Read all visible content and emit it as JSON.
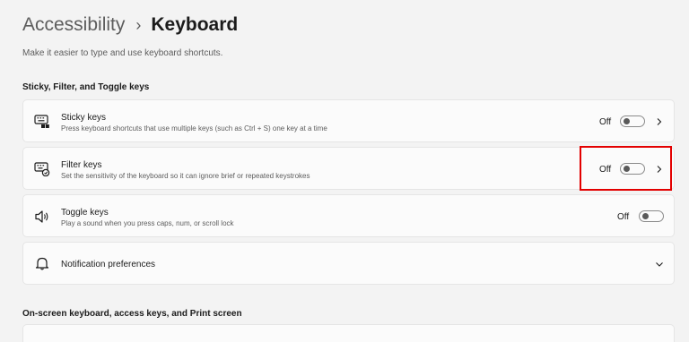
{
  "breadcrumb": {
    "parent": "Accessibility",
    "separator": "›",
    "current": "Keyboard"
  },
  "description": "Make it easier to type and use keyboard shortcuts.",
  "sections": {
    "sticky_filter_toggle": "Sticky, Filter, and Toggle keys",
    "onscreen": "On-screen keyboard, access keys, and Print screen"
  },
  "settings": {
    "sticky": {
      "title": "Sticky keys",
      "subtitle": "Press keyboard shortcuts that use multiple keys (such as Ctrl + S) one key at a time",
      "state": "Off",
      "icon": "sticky-keys-icon"
    },
    "filter": {
      "title": "Filter keys",
      "subtitle": "Set the sensitivity of the keyboard so it can ignore brief or repeated keystrokes",
      "state": "Off",
      "icon": "filter-keys-icon"
    },
    "toggle": {
      "title": "Toggle keys",
      "subtitle": "Play a sound when you press caps, num, or scroll lock",
      "state": "Off",
      "icon": "speaker-icon"
    },
    "notifications": {
      "title": "Notification preferences",
      "icon": "bell-icon"
    }
  },
  "colors": {
    "highlight": "#e30000",
    "card_bg": "#fbfbfb",
    "page_bg": "#f3f3f3"
  }
}
